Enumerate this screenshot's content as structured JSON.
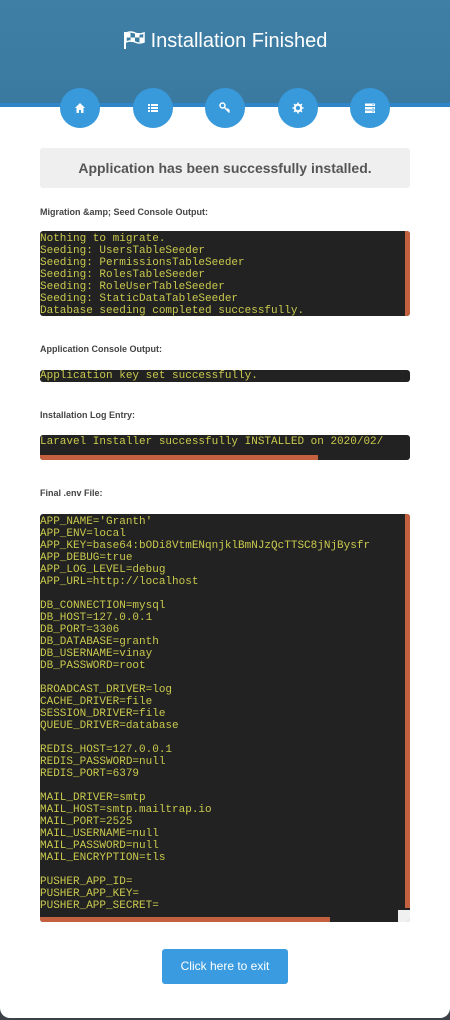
{
  "header": {
    "title": "Installation Finished",
    "accent_color": "#3a7aa0",
    "steps": [
      {
        "icon": "home-icon"
      },
      {
        "icon": "list-icon"
      },
      {
        "icon": "key-icon"
      },
      {
        "icon": "gear-icon"
      },
      {
        "icon": "server-icon"
      }
    ]
  },
  "message": "Application has been successfully installed.",
  "sections": {
    "migration_label": "Migration &amp; Seed Console Output:",
    "migration_output": "Nothing to migrate.\nSeeding: UsersTableSeeder\nSeeding: PermissionsTableSeeder\nSeeding: RolesTableSeeder\nSeeding: RoleUserTableSeeder\nSeeding: StaticDataTableSeeder\nDatabase seeding completed successfully.",
    "app_label": "Application Console Output:",
    "app_output": "Application key set successfully.",
    "log_label": "Installation Log Entry:",
    "log_output": "Laravel Installer successfully INSTALLED on 2020/02/",
    "env_label": "Final .env File:",
    "env_output": "APP_NAME='Granth'\nAPP_ENV=local\nAPP_KEY=base64:bODi8VtmENqnjklBmNJzQcTTSC8jNjBysfr\nAPP_DEBUG=true\nAPP_LOG_LEVEL=debug\nAPP_URL=http://localhost\n\nDB_CONNECTION=mysql\nDB_HOST=127.0.0.1\nDB_PORT=3306\nDB_DATABASE=granth\nDB_USERNAME=vinay\nDB_PASSWORD=root\n\nBROADCAST_DRIVER=log\nCACHE_DRIVER=file\nSESSION_DRIVER=file\nQUEUE_DRIVER=database\n\nREDIS_HOST=127.0.0.1\nREDIS_PASSWORD=null\nREDIS_PORT=6379\n\nMAIL_DRIVER=smtp\nMAIL_HOST=smtp.mailtrap.io\nMAIL_PORT=2525\nMAIL_USERNAME=null\nMAIL_PASSWORD=null\nMAIL_ENCRYPTION=tls\n\nPUSHER_APP_ID=\nPUSHER_APP_KEY=\nPUSHER_APP_SECRET="
  },
  "exit_button": "Click here to exit"
}
